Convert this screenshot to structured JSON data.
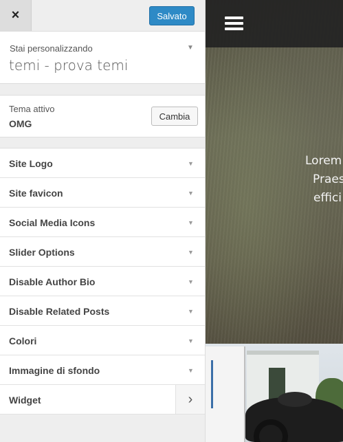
{
  "topbar": {
    "close_glyph": "×",
    "save_label": "Salvato"
  },
  "info": {
    "label": "Stai personalizzando",
    "title": "temi - prova temi"
  },
  "theme": {
    "label": "Tema attivo",
    "name": "OMG",
    "change_label": "Cambia"
  },
  "sections": [
    {
      "label": "Site Logo"
    },
    {
      "label": "Site favicon"
    },
    {
      "label": "Social Media Icons"
    },
    {
      "label": "Slider Options"
    },
    {
      "label": "Disable Author Bio"
    },
    {
      "label": "Disable Related Posts"
    },
    {
      "label": "Colori"
    },
    {
      "label": "Immagine di sfondo"
    },
    {
      "label": "Widget"
    }
  ],
  "preview": {
    "hero_lines": [
      "Lorem",
      "Praes",
      "effici"
    ]
  },
  "colors": {
    "accent": "#2e8ac6"
  },
  "icons": {
    "caret": "caret-down-icon",
    "chevron": "chevron-right-icon",
    "menu": "hamburger-icon"
  }
}
